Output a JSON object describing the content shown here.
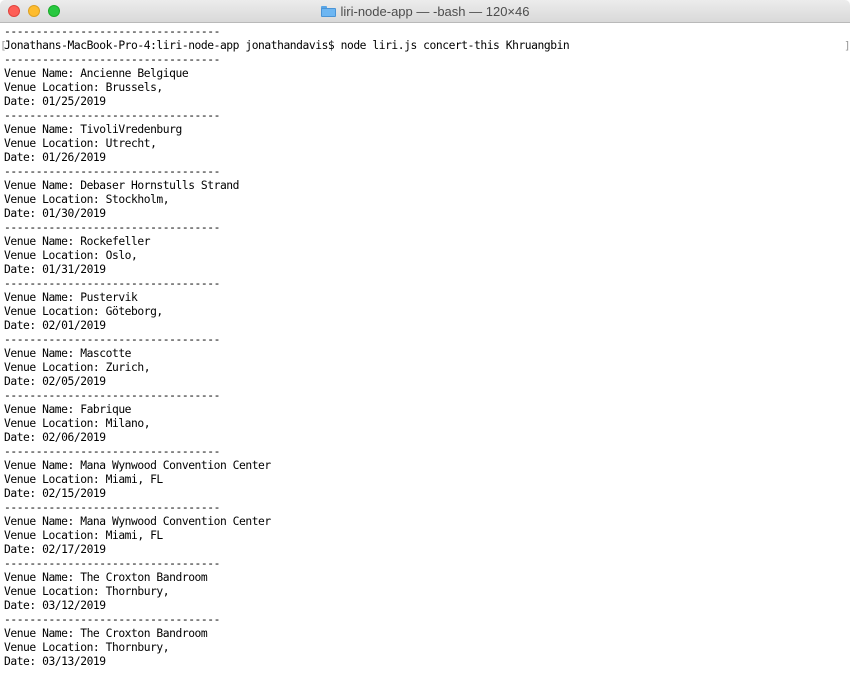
{
  "window": {
    "title": "liri-node-app — -bash — 120×46",
    "folder_icon": "folder-icon"
  },
  "terminal": {
    "lines": [
      "----------------------------------",
      "Jonathans-MacBook-Pro-4:liri-node-app jonathandavis$ node liri.js concert-this Khruangbin",
      "----------------------------------",
      "Venue Name: Ancienne Belgique",
      "Venue Location: Brussels,",
      "Date: 01/25/2019",
      "----------------------------------",
      "Venue Name: TivoliVredenburg",
      "Venue Location: Utrecht,",
      "Date: 01/26/2019",
      "----------------------------------",
      "Venue Name: Debaser Hornstulls Strand",
      "Venue Location: Stockholm,",
      "Date: 01/30/2019",
      "----------------------------------",
      "Venue Name: Rockefeller",
      "Venue Location: Oslo,",
      "Date: 01/31/2019",
      "----------------------------------",
      "Venue Name: Pustervik",
      "Venue Location: Göteborg,",
      "Date: 02/01/2019",
      "----------------------------------",
      "Venue Name: Mascotte",
      "Venue Location: Zurich,",
      "Date: 02/05/2019",
      "----------------------------------",
      "Venue Name: Fabrique",
      "Venue Location: Milano,",
      "Date: 02/06/2019",
      "----------------------------------",
      "Venue Name: Mana Wynwood Convention Center",
      "Venue Location: Miami, FL",
      "Date: 02/15/2019",
      "----------------------------------",
      "Venue Name: Mana Wynwood Convention Center",
      "Venue Location: Miami, FL",
      "Date: 02/17/2019",
      "----------------------------------",
      "Venue Name: The Croxton Bandroom",
      "Venue Location: Thornbury,",
      "Date: 03/12/2019",
      "----------------------------------",
      "Venue Name: The Croxton Bandroom",
      "Venue Location: Thornbury,",
      "Date: 03/13/2019"
    ],
    "prompt_left_bracket": "[",
    "prompt_right_bracket": "]"
  }
}
